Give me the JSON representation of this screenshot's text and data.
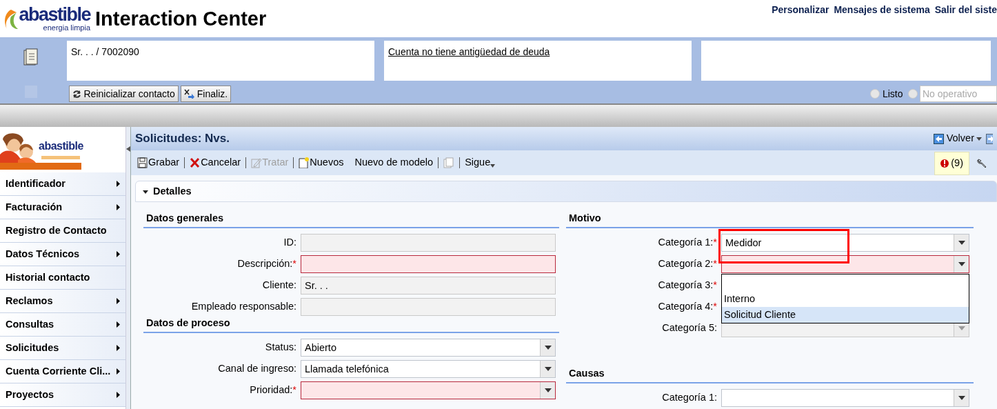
{
  "header": {
    "logo_name": "abastible",
    "logo_tagline": "energia limpia",
    "title": "Interaction Center",
    "links": [
      "Personalizar",
      "Mensajes de sistema",
      "Salir del siste"
    ]
  },
  "contact_bar": {
    "boxes": [
      {
        "text": "Sr. . . / 7002090",
        "link": false
      },
      {
        "text": "Cuenta no tiene antigüedad de deuda",
        "link": true
      }
    ],
    "buttons": [
      {
        "label": "Reinicializar contacto"
      },
      {
        "label": "Finaliz."
      }
    ],
    "status": {
      "options": [
        {
          "label": "Listo",
          "selected": false
        },
        {
          "selected": false
        }
      ],
      "field_value": "No operativo"
    }
  },
  "sidebar": {
    "logo_name": "abastible",
    "items": [
      {
        "label": "Identificador",
        "submenu": true
      },
      {
        "label": "Facturación",
        "submenu": true
      },
      {
        "label": "Registro de Contacto",
        "submenu": false
      },
      {
        "label": "Datos Técnicos",
        "submenu": true
      },
      {
        "label": "Historial contacto",
        "submenu": false
      },
      {
        "label": "Reclamos",
        "submenu": true
      },
      {
        "label": "Consultas",
        "submenu": true
      },
      {
        "label": "Solicitudes",
        "submenu": true
      },
      {
        "label": "Cuenta Corriente Cli...",
        "submenu": true
      },
      {
        "label": "Proyectos",
        "submenu": true
      }
    ]
  },
  "page": {
    "title": "Solicitudes: Nvs.",
    "back_button": "Volver",
    "messages": "(9)",
    "toolbar": [
      {
        "label": "Grabar",
        "disabled": false
      },
      {
        "label": "Cancelar",
        "disabled": false
      },
      {
        "label": "Tratar",
        "disabled": true
      },
      {
        "label": "Nuevos",
        "disabled": false
      },
      {
        "label": "Nuevo de modelo",
        "disabled": false
      },
      {
        "disabled": true
      },
      {
        "label": "Sigue",
        "disabled": false
      }
    ],
    "panel": {
      "title": "Detalles",
      "expanded": true,
      "left": [
        {
          "heading": "Datos generales",
          "fields": [
            {
              "label": "ID:",
              "kind": "text",
              "required": false,
              "disabled": true
            },
            {
              "label": "Descripción:",
              "mark": "*",
              "kind": "text",
              "required": true,
              "disabled": false
            },
            {
              "label": "Cliente:",
              "kind": "text",
              "value": "Sr. . .",
              "required": false,
              "disabled": true
            },
            {
              "label": "Empleado responsable:",
              "kind": "text",
              "required": false,
              "disabled": true
            }
          ]
        },
        {
          "heading": "Datos de proceso",
          "fields": [
            {
              "label": "Status:",
              "kind": "select",
              "value": "Abierto",
              "required": false,
              "disabled": false
            },
            {
              "label": "Canal de ingreso:",
              "kind": "select",
              "value": "Llamada telefónica",
              "required": false,
              "disabled": false
            },
            {
              "label": "Prioridad:",
              "mark": "*",
              "kind": "select",
              "required": true,
              "disabled": false
            }
          ]
        }
      ],
      "right": [
        {
          "heading": "Motivo",
          "fields": [
            {
              "label": "Categoría 1:",
              "mark": "*",
              "kind": "select",
              "value": "Medidor",
              "required": true,
              "disabled": false
            },
            {
              "label": "Categoría 2:",
              "mark": "*",
              "kind": "select",
              "required": true,
              "disabled": false,
              "dropdown": [
                {
                  "label": "Interno",
                  "selected": false
                },
                {
                  "label": "Solicitud Cliente",
                  "selected": true
                }
              ]
            },
            {
              "label": "Categoría 3:",
              "mark": "*",
              "kind": "covered",
              "required": true
            },
            {
              "label": "Categoría 4:",
              "mark": "*",
              "kind": "covered",
              "required": true
            },
            {
              "label": "Categoría 5:",
              "kind": "select",
              "required": false,
              "disabled": true
            }
          ]
        },
        {
          "heading": "Causas",
          "fields": [
            {
              "label": "Categoría 1:",
              "kind": "select",
              "required": false,
              "disabled": false
            }
          ]
        }
      ]
    }
  }
}
